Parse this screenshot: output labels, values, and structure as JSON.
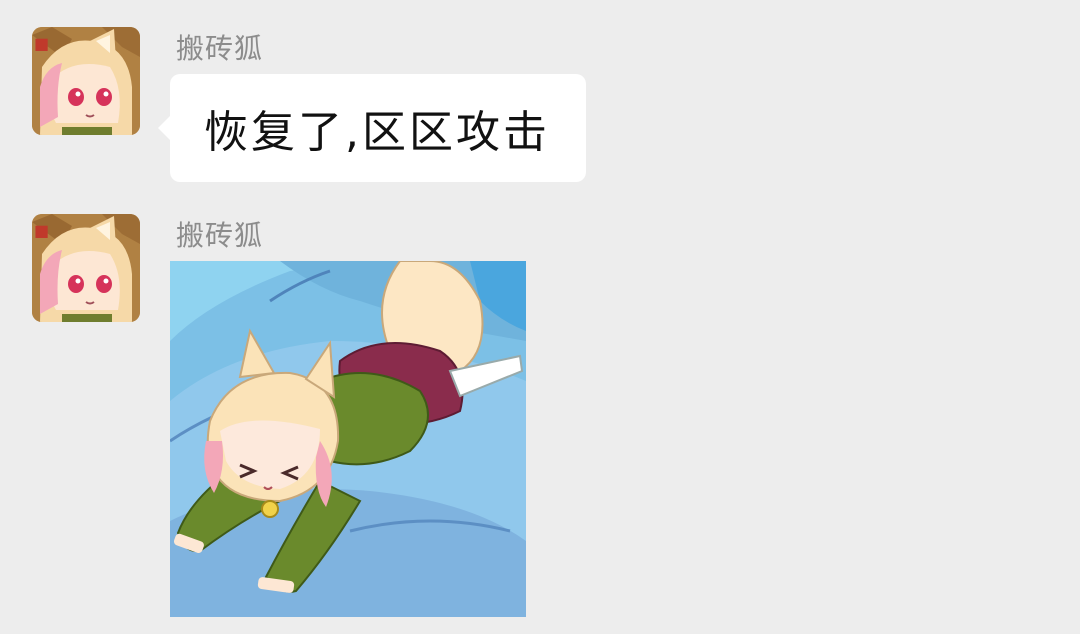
{
  "messages": [
    {
      "sender": "搬砖狐",
      "avatar_icon": "fox-girl-avatar-icon",
      "type": "text",
      "text": "恢复了,区区攻击"
    },
    {
      "sender": "搬砖狐",
      "avatar_icon": "fox-girl-avatar-icon",
      "type": "sticker",
      "sticker_icon": "fox-girl-lying-on-sofa-sticker"
    }
  ],
  "colors": {
    "background": "#ededed",
    "bubble": "#ffffff",
    "sender_name": "#8c8c8c",
    "message_text": "#111111"
  }
}
